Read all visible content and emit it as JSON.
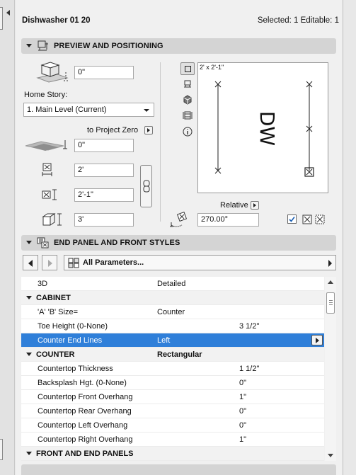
{
  "header": {
    "object_name": "Dishwasher 01 20",
    "selected_label": "Selected:",
    "selected_count": "1",
    "editable_label": "Editable:",
    "editable_count": "1"
  },
  "section_preview": {
    "title": "PREVIEW AND POSITIONING",
    "elevation_value": "0\"",
    "home_story_label": "Home Story:",
    "home_story_value": "1. Main Level (Current)",
    "to_project_zero_label": "to Project Zero",
    "project_zero_value": "0\"",
    "width_value": "2'",
    "depth_value": "2'-1\"",
    "height_value": "3'",
    "preview_size_label": "2' x 2'-1\"",
    "preview_symbol_text": "DW",
    "relative_label": "Relative",
    "angle_value": "270.00°"
  },
  "section_styles": {
    "title": "END PANEL AND FRONT STYLES",
    "param_select": "All Parameters..."
  },
  "parameters": [
    {
      "kind": "item",
      "name": "3D",
      "value": "Detailed",
      "extra": ""
    },
    {
      "kind": "group",
      "name": "CABINET",
      "value": ""
    },
    {
      "kind": "item",
      "name": "'A' 'B' Size=",
      "value": "Counter",
      "extra": ""
    },
    {
      "kind": "item",
      "name": "Toe Height (0-None)",
      "value": "",
      "extra": "3 1/2\""
    },
    {
      "kind": "selected",
      "name": "Counter End Lines",
      "value": "Left",
      "extra": ""
    },
    {
      "kind": "group",
      "name": "COUNTER",
      "value": "Rectangular"
    },
    {
      "kind": "item",
      "name": "Countertop Thickness",
      "value": "",
      "extra": "1 1/2\""
    },
    {
      "kind": "item",
      "name": "Backsplash Hgt. (0-None)",
      "value": "",
      "extra": "0\""
    },
    {
      "kind": "item",
      "name": "Countertop Front Overhang",
      "value": "",
      "extra": "1\""
    },
    {
      "kind": "item",
      "name": "Countertop Rear Overhang",
      "value": "",
      "extra": "0\""
    },
    {
      "kind": "item",
      "name": "Countertop Left Overhang",
      "value": "",
      "extra": "0\""
    },
    {
      "kind": "item",
      "name": "Countertop Right Overhang",
      "value": "",
      "extra": "1\""
    },
    {
      "kind": "group",
      "name": "FRONT AND END PANELS",
      "value": ""
    }
  ],
  "colors": {
    "selection": "#2f7fd9",
    "section_header": "#d4d4d4",
    "panel_bg": "#f0f0f0"
  },
  "icons": [
    "collapse-arrow-icon",
    "preview-positioning-icon",
    "floor-plan-icon",
    "elevation-icon",
    "project-zero-icon",
    "width-icon",
    "depth-icon",
    "height-icon",
    "chain-link-icon",
    "square-view-icon",
    "plan-view-icon",
    "3d-box-icon",
    "section-view-icon",
    "info-icon",
    "rotation-icon",
    "mirror-icon",
    "styles-icon",
    "prev-arrow-icon",
    "next-arrow-icon",
    "parameters-icon"
  ]
}
